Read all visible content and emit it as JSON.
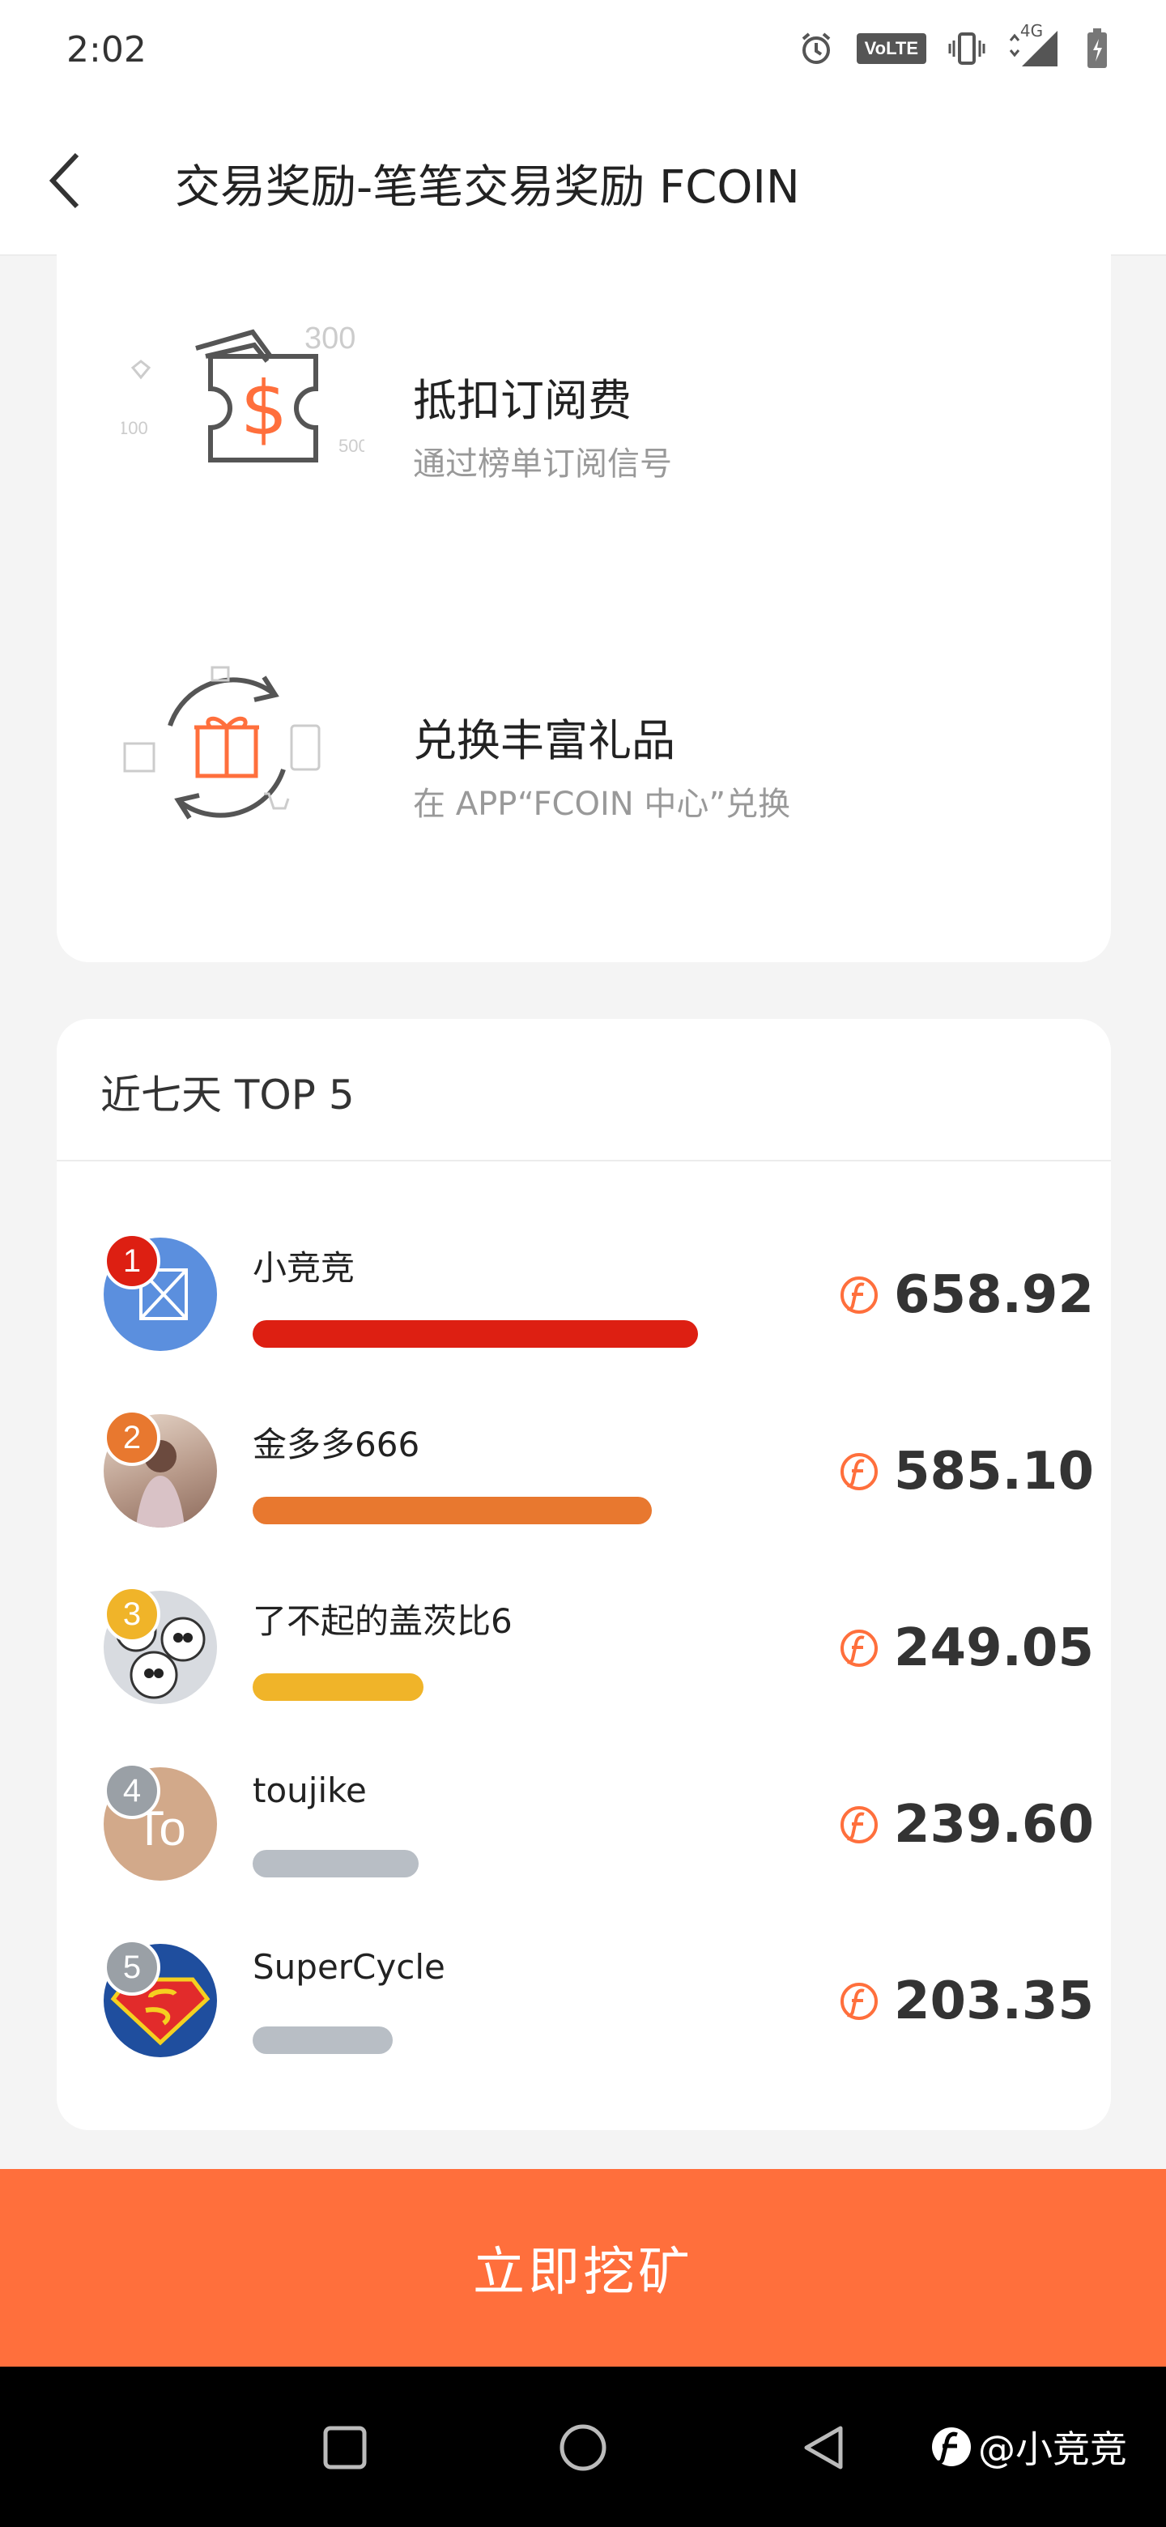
{
  "status_bar": {
    "time": "2:02",
    "volte": "VoLTE",
    "network": "4G"
  },
  "header": {
    "title": "交易奖励-笔笔交易奖励 FCOIN"
  },
  "benefits": [
    {
      "title": "抵扣订阅费",
      "desc": "通过榜单订阅信号",
      "tags": [
        "300",
        "100",
        "500"
      ]
    },
    {
      "title": "兑换丰富礼品",
      "desc": "在 APP“FCOIN 中心”兑换"
    }
  ],
  "leaderboard": {
    "title": "近七天 TOP 5",
    "entries": [
      {
        "rank": "1",
        "name": "小竞竞",
        "value": "658.92",
        "bar_fraction": 0.86,
        "color": "#dd1f12"
      },
      {
        "rank": "2",
        "name": "金多多666",
        "value": "585.10",
        "bar_fraction": 0.77,
        "color": "#e8782f"
      },
      {
        "rank": "3",
        "name": "了不起的盖茨比6",
        "value": "249.05",
        "bar_fraction": 0.33,
        "color": "#f0b429"
      },
      {
        "rank": "4",
        "name": "toujike",
        "value": "239.60",
        "bar_fraction": 0.32,
        "color": "#b8bec5"
      },
      {
        "rank": "5",
        "name": "SuperCycle",
        "value": "203.35",
        "bar_fraction": 0.27,
        "color": "#b8bec5"
      }
    ],
    "avatar_text_4": "To"
  },
  "cta": {
    "label": "立即挖矿"
  },
  "watermark": "@小竞竞",
  "colors": {
    "accent": "#ff6f3c",
    "rank1": "#dd1f12",
    "rank2": "#e8782f",
    "rank3": "#f0b429",
    "rank_other": "#9aa0a6"
  }
}
